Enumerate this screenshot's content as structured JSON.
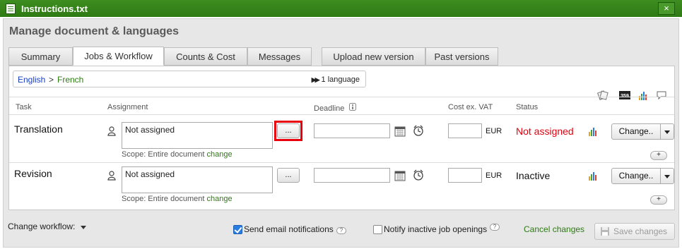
{
  "window": {
    "title": "Instructions.txt",
    "close_glyph": "×"
  },
  "panel": {
    "title": "Manage document & languages"
  },
  "tabs": [
    {
      "label": "Summary"
    },
    {
      "label": "Jobs & Workflow"
    },
    {
      "label": "Counts & Cost"
    },
    {
      "label": "Messages"
    },
    {
      "label": "Upload new version"
    },
    {
      "label": "Past versions"
    }
  ],
  "languages": {
    "source": "English",
    "arrow": ">",
    "target": "French",
    "count": "1 language"
  },
  "columns": {
    "task": "Task",
    "assignment": "Assignment",
    "deadline": "Deadline",
    "cost": "Cost ex. VAT",
    "status": "Status"
  },
  "jobs": [
    {
      "task": "Translation",
      "assignee": "Not assigned",
      "scope_label": "Scope: Entire document",
      "scope_link": "change",
      "dots": "...",
      "deadline": "",
      "cost": "",
      "currency": "EUR",
      "status": "Not assigned",
      "status_color": "#e3000f",
      "change_label": "Change..",
      "plus": "+"
    },
    {
      "task": "Revision",
      "assignee": "Not assigned",
      "scope_label": "Scope: Entire document",
      "scope_link": "change",
      "dots": "...",
      "deadline": "",
      "cost": "",
      "currency": "EUR",
      "status": "Inactive",
      "status_color": "#111111",
      "change_label": "Change..",
      "plus": "+"
    }
  ],
  "footer": {
    "workflow_label": "Change workflow:",
    "send_email_label": "Send email notifications",
    "send_email_checked": true,
    "notify_inactive_label": "Notify inactive job openings",
    "notify_inactive_checked": false,
    "cancel_label": "Cancel changes",
    "save_label": "Save changes"
  },
  "icons": {
    "tools": [
      "tm-icon",
      "wordcount-icon",
      "chart-icon",
      "comment-icon"
    ],
    "accent_green": "#2e7a14",
    "link_blue": "#1a3fbf"
  }
}
